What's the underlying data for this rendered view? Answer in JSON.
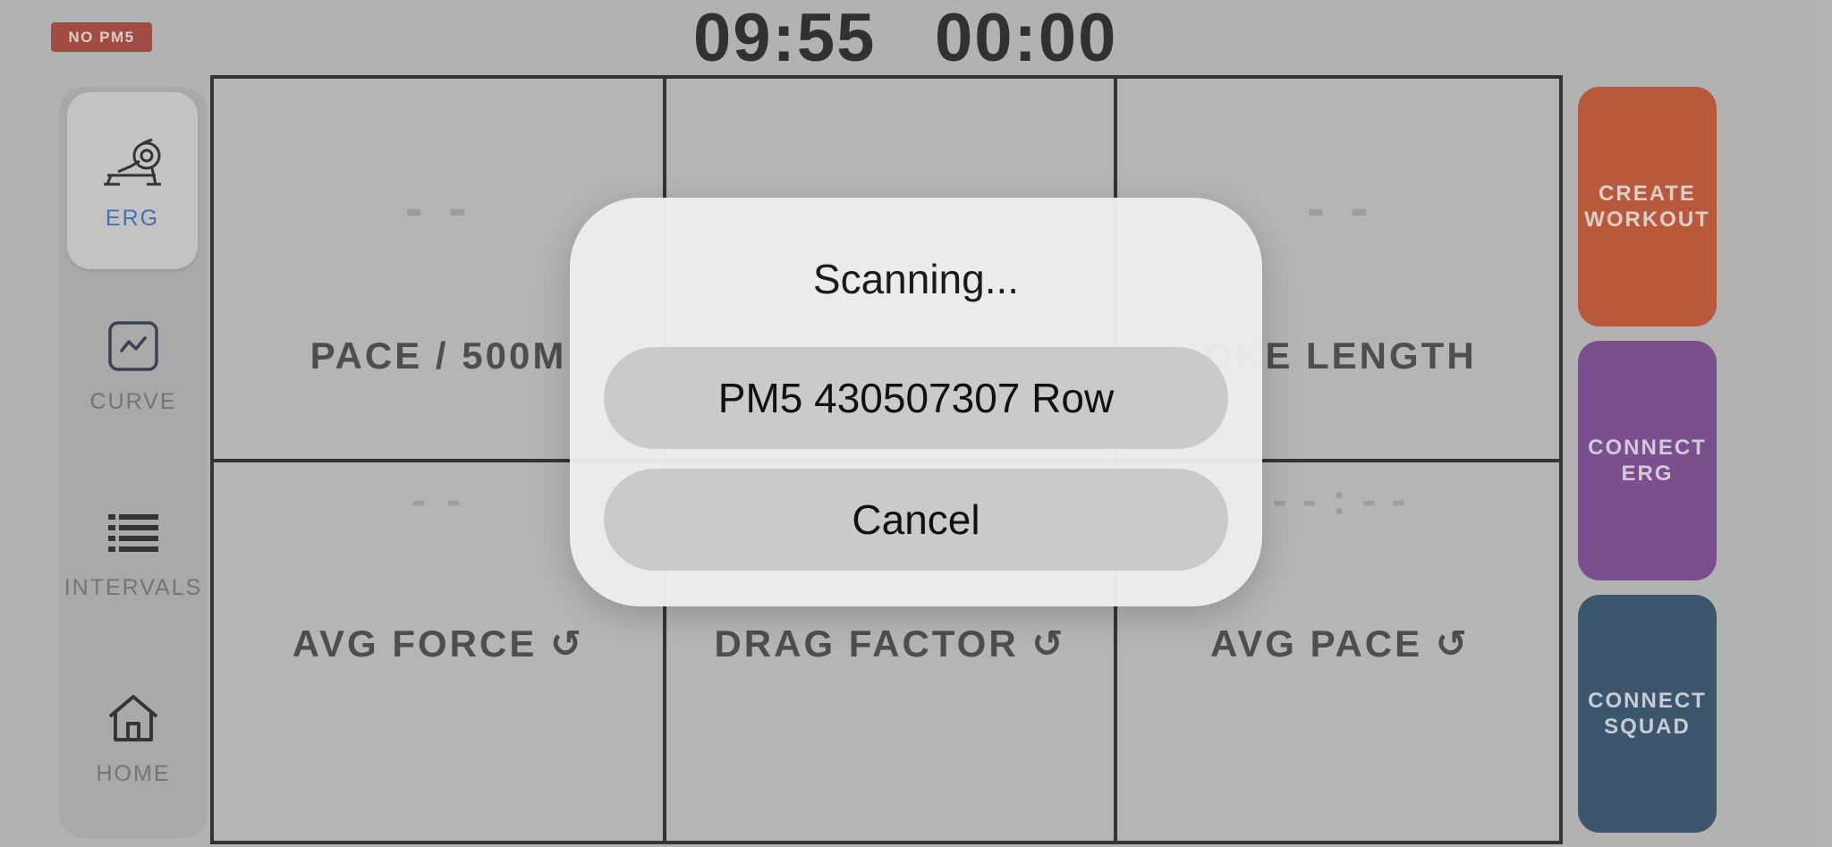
{
  "status_badge": "NO PM5",
  "header": {
    "time": "09:55",
    "elapsed": "00:00"
  },
  "sidebar": {
    "items": [
      {
        "label": "ERG",
        "icon": "rowing-machine-icon",
        "active": true
      },
      {
        "label": "CURVE",
        "icon": "line-chart-icon",
        "active": false
      },
      {
        "label": "INTERVALS",
        "icon": "list-icon",
        "active": false
      },
      {
        "label": "HOME",
        "icon": "home-icon",
        "active": false
      }
    ]
  },
  "metrics": {
    "pace": {
      "label": "PACE / 500M",
      "value": "- -"
    },
    "stroke_length": {
      "label": "OKE LENGTH",
      "value": "- -"
    },
    "avg_force": {
      "label": "AVG FORCE ↺",
      "value": "- -"
    },
    "drag_factor": {
      "label": "DRAG FACTOR ↺",
      "value": ""
    },
    "avg_pace": {
      "label": "AVG PACE ↺",
      "value": "- - : - -"
    }
  },
  "actions": {
    "create_workout": {
      "label": "CREATE\nWORKOUT",
      "color": "#c0421b"
    },
    "connect_erg": {
      "label": "CONNECT\nERG",
      "color": "#6e3488"
    },
    "connect_squad": {
      "label": "CONNECT\nSQUAD",
      "color": "#1b3f5d"
    }
  },
  "dialog": {
    "title": "Scanning...",
    "device_option": "PM5 430507307 Row",
    "cancel": "Cancel"
  },
  "colors": {
    "accent_blue": "#2760b6",
    "badge_red": "#a23024"
  }
}
